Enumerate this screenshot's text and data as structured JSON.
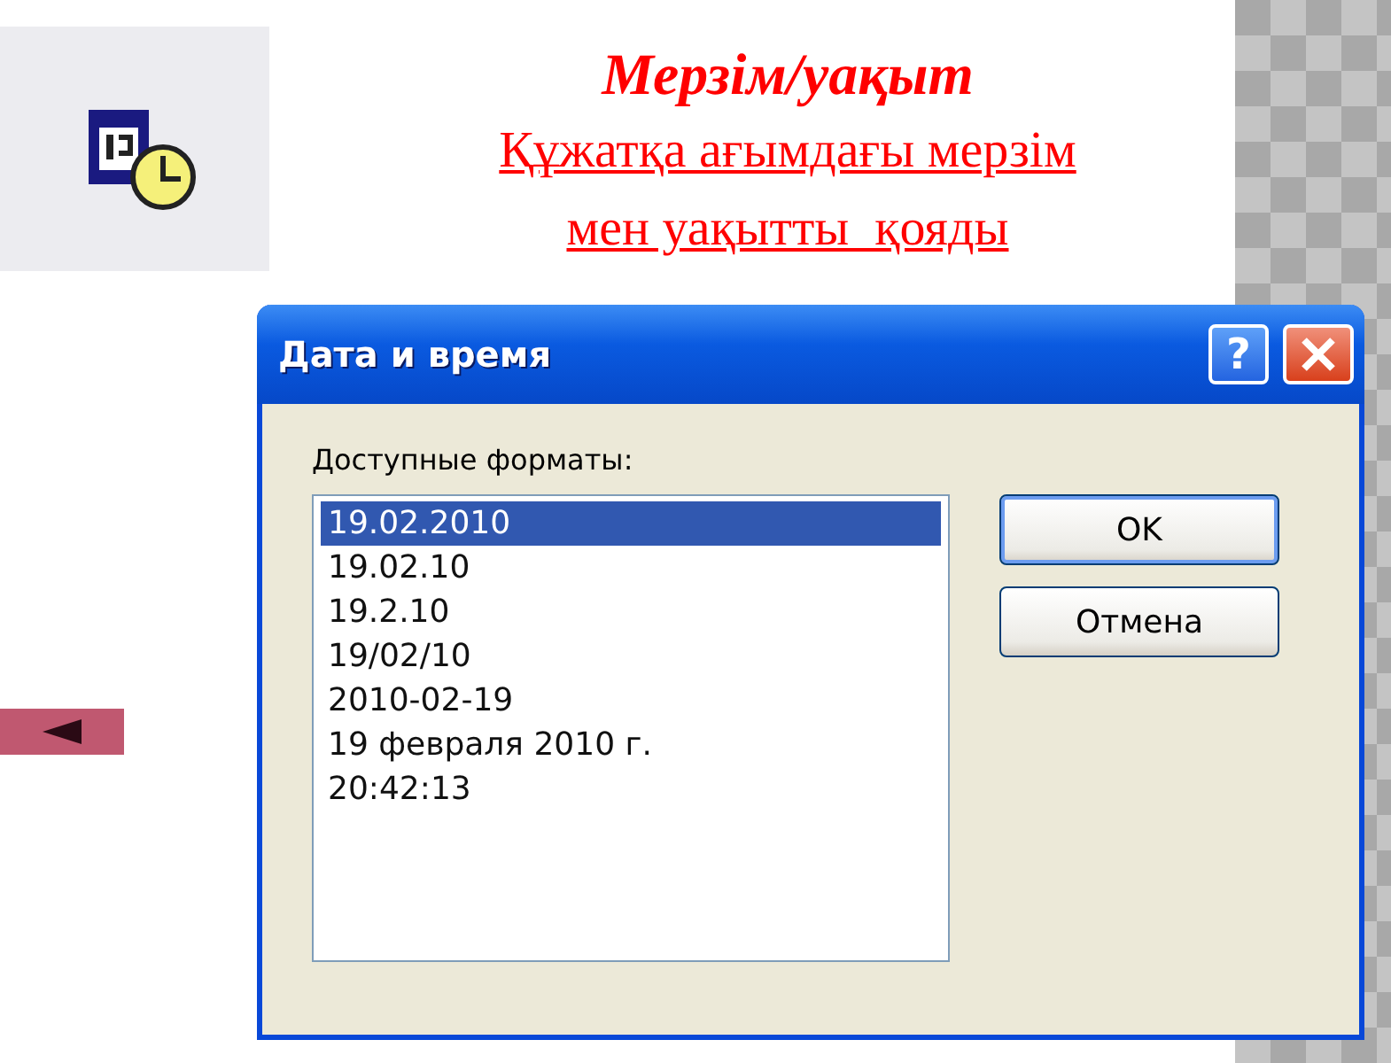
{
  "slide": {
    "title": "Мерзім/уақыт",
    "subtitle_lines": [
      "Құжатқа ағымдағы мерзім",
      "мен уақытты  қояды"
    ]
  },
  "dialog": {
    "title": "Дата и время",
    "help_button": "?",
    "list_label": "Доступные форматы:",
    "formats": [
      {
        "text": "19.02.2010",
        "selected": true
      },
      {
        "text": "19.02.10",
        "selected": false
      },
      {
        "text": "19.2.10",
        "selected": false
      },
      {
        "text": "19/02/10",
        "selected": false
      },
      {
        "text": "2010-02-19",
        "selected": false
      },
      {
        "text": "19 февраля 2010 г.",
        "selected": false
      },
      {
        "text": "20:42:13",
        "selected": false
      }
    ],
    "buttons": [
      {
        "label": "OK",
        "default": true
      },
      {
        "label": "Отмена",
        "default": false
      }
    ]
  }
}
